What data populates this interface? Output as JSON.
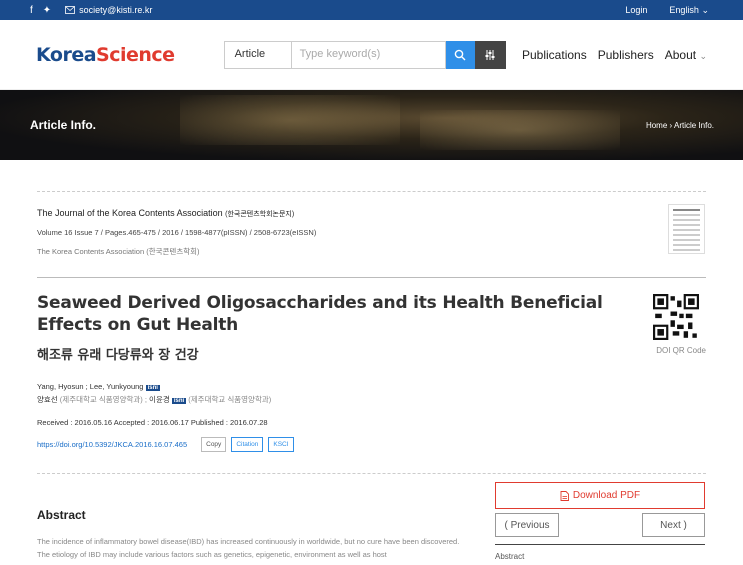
{
  "topbar": {
    "facebook_icon": "f",
    "twitter_icon": "✦",
    "email": "society@kisti.re.kr",
    "login": "Login",
    "language": "English"
  },
  "header": {
    "logo_part1": "Korea",
    "logo_part2": "Science",
    "search_type": "Article",
    "search_placeholder": "Type keyword(s)",
    "nav": [
      "Publications",
      "Publishers",
      "About"
    ]
  },
  "banner": {
    "title": "Article Info.",
    "breadcrumb_home": "Home",
    "breadcrumb_sep": "›",
    "breadcrumb_current": "Article Info."
  },
  "journal": {
    "name": "The Journal of the Korea Contents Association",
    "name_kr": "(한국콘텐츠학회논문지)",
    "volume_line": "Volume 16 Issue 7  /  Pages.465-475  /  2016  /  1598-4877(pISSN)  /  2508-6723(eISSN)",
    "publisher": "The Korea Contents Association (한국콘텐츠학회)"
  },
  "article": {
    "title": "Seaweed Derived Oligosaccharides and its Health Beneficial Effects on Gut Health",
    "title_kr": "해조류 유래 다당류와 장 건강",
    "qr_label": "DOI QR Code",
    "authors_en_1": "Yang, Hyosun ;  Lee, Yunkyoung",
    "isni": "isni",
    "author_kr_1": "양효선",
    "author_kr_1_aff": "(제주대학교 식품영양학과) ;",
    "author_kr_2": "이윤경",
    "author_kr_2_aff": "(제주대학교 식품영양학과)",
    "dates": "Received : 2016.05.16   Accepted : 2016.06.17   Published : 2016.07.28",
    "doi": "https://doi.org/10.5392/JKCA.2016.16.07.465",
    "copy": "Copy",
    "citation": "Citation",
    "ksci": "KSCI"
  },
  "abstract": {
    "heading": "Abstract",
    "text": "The incidence of inflammatory bowel disease(IBD) has increased continuously in worldwide, but no cure have been discovered. The etiology of IBD may include various factors such as genetics, epigenetic, environment as well as host"
  },
  "side": {
    "download": "Download PDF",
    "previous": "( Previous",
    "next": "Next )",
    "section_label": "Abstract"
  },
  "colors": {
    "brand_blue": "#1a4b8c",
    "accent_red": "#e03b2f",
    "search_blue": "#2f8fe8"
  }
}
